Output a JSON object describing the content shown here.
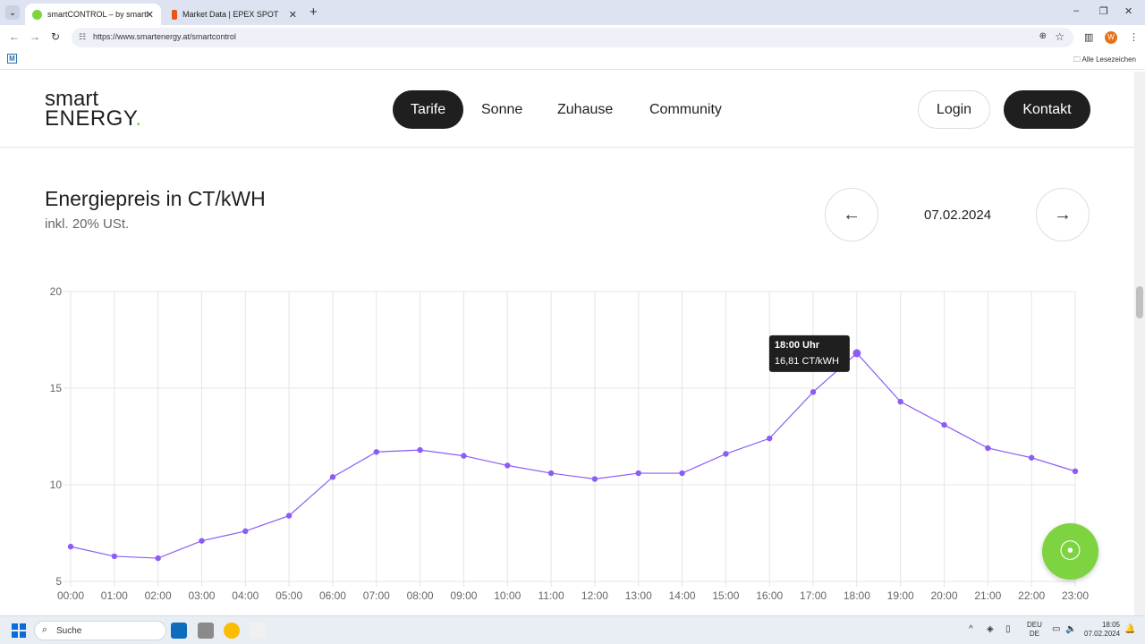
{
  "browser": {
    "tabs": [
      {
        "title": "smartCONTROL – by smartENERGY",
        "active": true
      },
      {
        "title": "Market Data | EPEX SPOT",
        "active": false
      }
    ],
    "url": "https://www.smartenergy.at/smartcontrol",
    "profile_initial": "W",
    "bookmarks_label": "Alle Lesezeichen",
    "bookmark_icon_letter": "M"
  },
  "site": {
    "logo_line1": "smart",
    "logo_line2": "ENERGY",
    "logo_dot": ".",
    "nav": [
      {
        "label": "Tarife",
        "active": true
      },
      {
        "label": "Sonne",
        "active": false
      },
      {
        "label": "Zuhause",
        "active": false
      },
      {
        "label": "Community",
        "active": false
      }
    ],
    "login_label": "Login",
    "kontakt_label": "Kontakt",
    "accent_color": "#8b5cf6"
  },
  "section": {
    "title": "Energiepreis in CT/kWH",
    "subtitle": "inkl. 20% USt.",
    "date": "07.02.2024",
    "prev_icon": "arrow-left-icon",
    "next_icon": "arrow-right-icon"
  },
  "chart_data": {
    "type": "line",
    "title": "",
    "xlabel": "",
    "ylabel": "",
    "x": [
      "00:00",
      "01:00",
      "02:00",
      "03:00",
      "04:00",
      "05:00",
      "06:00",
      "07:00",
      "08:00",
      "09:00",
      "10:00",
      "11:00",
      "12:00",
      "13:00",
      "14:00",
      "15:00",
      "16:00",
      "17:00",
      "18:00",
      "19:00",
      "20:00",
      "21:00",
      "22:00",
      "23:00"
    ],
    "values": [
      6.8,
      6.3,
      6.2,
      7.1,
      7.6,
      8.4,
      10.4,
      11.7,
      11.8,
      11.5,
      11.0,
      10.6,
      10.3,
      10.6,
      10.6,
      11.6,
      12.4,
      14.8,
      16.81,
      14.3,
      13.1,
      11.9,
      11.4,
      10.7
    ],
    "ylim": [
      5,
      20
    ],
    "yticks": [
      5,
      10,
      15,
      20
    ],
    "grid": true,
    "color": "#8b5cf6",
    "tooltip": {
      "index": 18,
      "title": "18:00 Uhr",
      "value_text": "16,81 CT/kWH"
    }
  },
  "taskbar": {
    "search_placeholder": "Suche",
    "lang_top": "DEU",
    "lang_bottom": "DE",
    "time": "18:05",
    "date": "07.02.2024"
  }
}
